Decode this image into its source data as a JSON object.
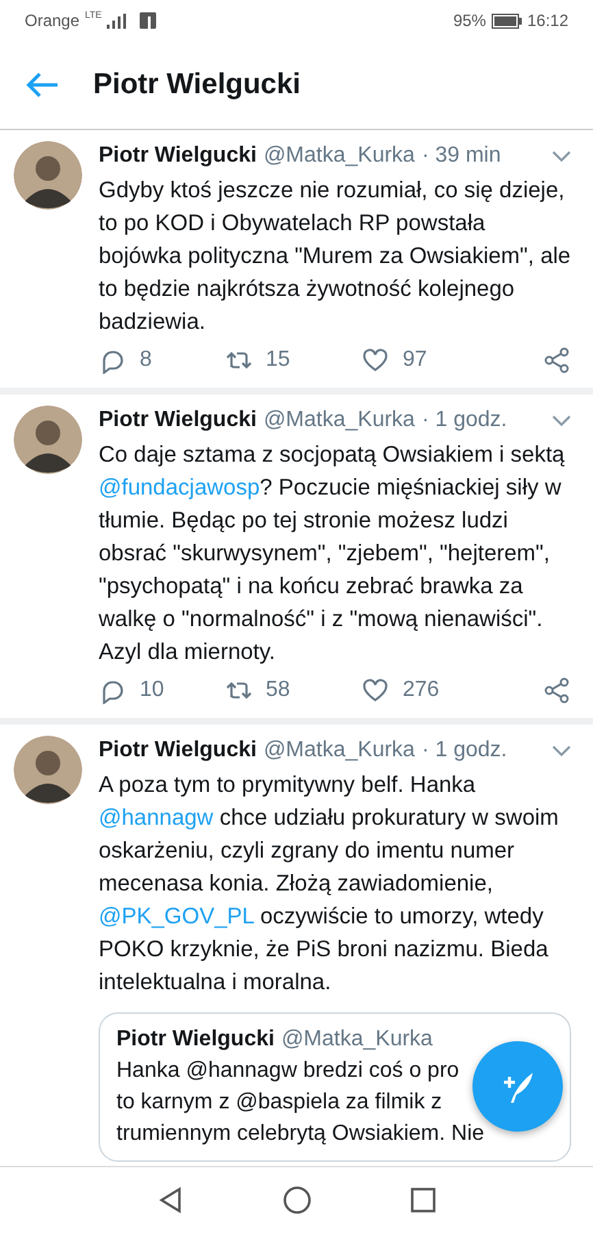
{
  "status_bar": {
    "carrier": "Orange",
    "network": "LTE",
    "battery": "95%",
    "time": "16:12"
  },
  "header": {
    "title": "Piotr Wielgucki"
  },
  "tweets": [
    {
      "name": "Piotr Wielgucki",
      "handle": "@Matka_Kurka",
      "time": "· 39 min",
      "text": [
        {
          "kind": "text",
          "text": "Gdyby ktoś jeszcze nie rozumiał, co się dzieje, to po KOD i Obywatelach RP powstała bojówka polityczna \"Murem za Owsiakiem\", ale to będzie najkrótsza żywotność kolejnego badziewia."
        }
      ],
      "replies": "8",
      "retweets": "15",
      "likes": "97"
    },
    {
      "name": "Piotr Wielgucki",
      "handle": "@Matka_Kurka",
      "time": "· 1 godz.",
      "text": [
        {
          "kind": "text",
          "text": "Co daje sztama z socjopatą Owsiakiem i sektą "
        },
        {
          "kind": "mention",
          "text": "@fundacjawosp"
        },
        {
          "kind": "text",
          "text": "? Poczucie mięśniackiej siły w tłumie. Będąc po tej stronie możesz ludzi obsrać \"skurwysynem\", \"zjebem\", \"hejterem\", \"psychopatą\" i na końcu zebrać brawka za walkę o \"normalność\" i z \"mową nienawiści\". Azyl dla miernoty."
        }
      ],
      "replies": "10",
      "retweets": "58",
      "likes": "276"
    },
    {
      "name": "Piotr Wielgucki",
      "handle": "@Matka_Kurka",
      "time": "· 1 godz.",
      "text": [
        {
          "kind": "text",
          "text": "A poza tym to prymitywny belf. Hanka "
        },
        {
          "kind": "mention",
          "text": "@hannagw"
        },
        {
          "kind": "text",
          "text": " chce udziału prokuratury w swoim oskarżeniu,  czyli zgrany do imentu numer mecenasa konia. Złożą zawiadomienie, "
        },
        {
          "kind": "mention",
          "text": "@PK_GOV_PL"
        },
        {
          "kind": "text",
          "text": " oczywiście to umorzy, wtedy POKO krzyknie, że PiS broni nazizmu. Bieda intelektualna i moralna."
        }
      ],
      "quote": {
        "name": "Piotr Wielgucki",
        "handle": "@Matka_Kurka",
        "lines": [
          "Hanka @hannagw bredzi coś o pro",
          "to karnym z @baspiela za filmik z",
          "trumiennym celebrytą Owsiakiem. Nie"
        ]
      }
    }
  ]
}
